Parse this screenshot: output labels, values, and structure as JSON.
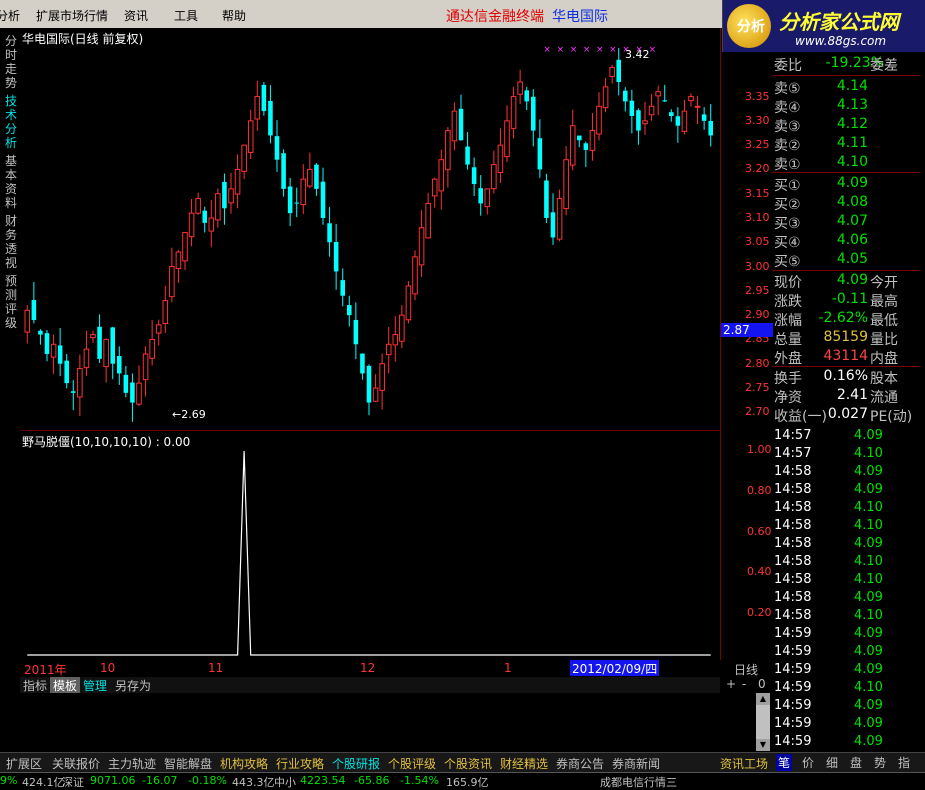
{
  "menu": {
    "items": [
      "分析",
      "扩展市场行情",
      "资讯",
      "工具",
      "帮助"
    ],
    "title": "通达信金融终端",
    "stock_name": "华电国际"
  },
  "logo": {
    "badge": "分析",
    "brand": "分析家公式网",
    "url": "www.88gs.com"
  },
  "side_tabs": [
    "分时走势",
    "技术分析",
    "基本资料",
    "财务透视",
    "预测评级"
  ],
  "main_chart_title": "华电国际(日线 前复权)",
  "indicator_title": "野马脱僵(10,10,10,10) : 0.00",
  "chart_data": [
    {
      "type": "candlestick",
      "title": "华电国际(日线 前复权)",
      "y_ticks": [
        "3.35",
        "3.30",
        "3.25",
        "3.20",
        "3.15",
        "3.10",
        "3.05",
        "3.00",
        "2.95",
        "2.90",
        "2.85",
        "2.80",
        "2.75",
        "2.70"
      ],
      "ylim": [
        2.68,
        3.45
      ],
      "annotations": {
        "high_label": "3.42",
        "low_label": "2.69",
        "current_price": "2.87"
      },
      "colors": {
        "up": "#ff3232",
        "down": "#00ffff"
      },
      "closes": [
        2.91,
        2.89,
        2.86,
        2.82,
        2.84,
        2.8,
        2.76,
        2.74,
        2.79,
        2.83,
        2.86,
        2.81,
        2.85,
        2.8,
        2.78,
        2.74,
        2.72,
        2.76,
        2.82,
        2.85,
        2.88,
        2.93,
        3.0,
        3.03,
        3.07,
        3.11,
        3.14,
        3.09,
        3.1,
        3.15,
        3.12,
        3.16,
        3.2,
        3.25,
        3.3,
        3.35,
        3.32,
        3.27,
        3.22,
        3.16,
        3.11,
        3.13,
        3.18,
        3.2,
        3.16,
        3.1,
        3.05,
        2.99,
        2.94,
        2.9,
        2.84,
        2.78,
        2.72,
        2.75,
        2.8,
        2.84,
        2.86,
        2.9,
        2.96,
        3.02,
        3.08,
        3.13,
        3.18,
        3.22,
        3.28,
        3.32,
        3.26,
        3.21,
        3.17,
        3.13,
        3.16,
        3.21,
        3.25,
        3.3,
        3.35,
        3.38,
        3.34,
        3.28,
        3.2,
        3.1,
        3.06,
        3.14,
        3.22,
        3.29,
        3.26,
        3.24,
        3.28,
        3.33,
        3.37,
        3.41,
        3.38,
        3.34,
        3.31,
        3.28,
        3.3,
        3.33,
        3.36,
        3.34,
        3.31,
        3.29,
        3.32,
        3.35,
        3.33,
        3.3,
        3.27
      ],
      "special_markers_count": 9
    },
    {
      "type": "line",
      "title": "野马脱僵(10,10,10,10) : 0.00",
      "y_ticks": [
        "1.00",
        "0.80",
        "0.60",
        "0.40",
        "0.20"
      ],
      "ylim": [
        0,
        1.0
      ],
      "spike_index": 33,
      "spike_value": 1.0,
      "n_points": 105,
      "color": "#ffffff"
    }
  ],
  "x_axis": {
    "labels": [
      "2011年",
      "10",
      "11",
      "12",
      "1"
    ],
    "selected_date": "2012/02/09/四",
    "period": "日线"
  },
  "indicator_tabs": [
    "指标",
    "模板",
    "管理",
    "另存为"
  ],
  "zoom": {
    "plus": "+",
    "minus": "-",
    "value": "0"
  },
  "quote": {
    "wei_bi": {
      "label": "委比",
      "value": "-19.23%",
      "right": "委差"
    },
    "asks": [
      {
        "label": "卖⑤",
        "price": "4.14"
      },
      {
        "label": "卖④",
        "price": "4.13"
      },
      {
        "label": "卖③",
        "price": "4.12"
      },
      {
        "label": "卖②",
        "price": "4.11"
      },
      {
        "label": "卖①",
        "price": "4.10"
      }
    ],
    "bids": [
      {
        "label": "买①",
        "price": "4.09"
      },
      {
        "label": "买②",
        "price": "4.08"
      },
      {
        "label": "买③",
        "price": "4.07"
      },
      {
        "label": "买④",
        "price": "4.06"
      },
      {
        "label": "买⑤",
        "price": "4.05"
      }
    ],
    "stats": [
      {
        "label": "现价",
        "value": "4.09",
        "right": "今开",
        "color": "grn"
      },
      {
        "label": "涨跌",
        "value": "-0.11",
        "right": "最高",
        "color": "grn"
      },
      {
        "label": "涨幅",
        "value": "-2.62%",
        "right": "最低",
        "color": "grn"
      },
      {
        "label": "总量",
        "value": "85159",
        "right": "量比",
        "color": "yel"
      },
      {
        "label": "外盘",
        "value": "43114",
        "right": "内盘",
        "color": "red"
      }
    ],
    "stats2": [
      {
        "label": "换手",
        "value": "0.16%",
        "right": "股本",
        "color": "wht"
      },
      {
        "label": "净资",
        "value": "2.41",
        "right": "流通",
        "color": "wht"
      },
      {
        "label": "收益(一)",
        "value": "0.027",
        "right": "PE(动)",
        "color": "wht"
      }
    ]
  },
  "ticks": [
    {
      "time": "14:57",
      "price": "4.09"
    },
    {
      "time": "14:57",
      "price": "4.10"
    },
    {
      "time": "14:58",
      "price": "4.09"
    },
    {
      "time": "14:58",
      "price": "4.09"
    },
    {
      "time": "14:58",
      "price": "4.10"
    },
    {
      "time": "14:58",
      "price": "4.10"
    },
    {
      "time": "14:58",
      "price": "4.09"
    },
    {
      "time": "14:58",
      "price": "4.10"
    },
    {
      "time": "14:58",
      "price": "4.10"
    },
    {
      "time": "14:58",
      "price": "4.09"
    },
    {
      "time": "14:58",
      "price": "4.10"
    },
    {
      "time": "14:59",
      "price": "4.09"
    },
    {
      "time": "14:59",
      "price": "4.09"
    },
    {
      "time": "14:59",
      "price": "4.09"
    },
    {
      "time": "14:59",
      "price": "4.10"
    },
    {
      "time": "14:59",
      "price": "4.09"
    },
    {
      "time": "14:59",
      "price": "4.09"
    },
    {
      "time": "14:59",
      "price": "4.09"
    }
  ],
  "bottom_tabs": [
    "扩展区",
    "关联报价",
    "主力轨迹",
    "智能解盘",
    "机构攻略",
    "行业攻略",
    "个股研报",
    "个股评级",
    "个股资讯",
    "财经精选",
    "券商公告",
    "券商新闻"
  ],
  "right_bottom_tabs": [
    "资讯工场",
    "笔",
    "价",
    "细",
    "盘",
    "势",
    "指"
  ],
  "status": {
    "s1": "9%",
    "s2": "424.1亿",
    "s3": "深证",
    "s4": "9071.06",
    "s5": "-16.07",
    "s6": "-0.18%",
    "s7": "443.3亿",
    "s8": "中小",
    "s9": "4223.54",
    "s10": "-65.86",
    "s11": "-1.54%",
    "s12": "165.9亿",
    "s13": "成都电信行情三"
  }
}
